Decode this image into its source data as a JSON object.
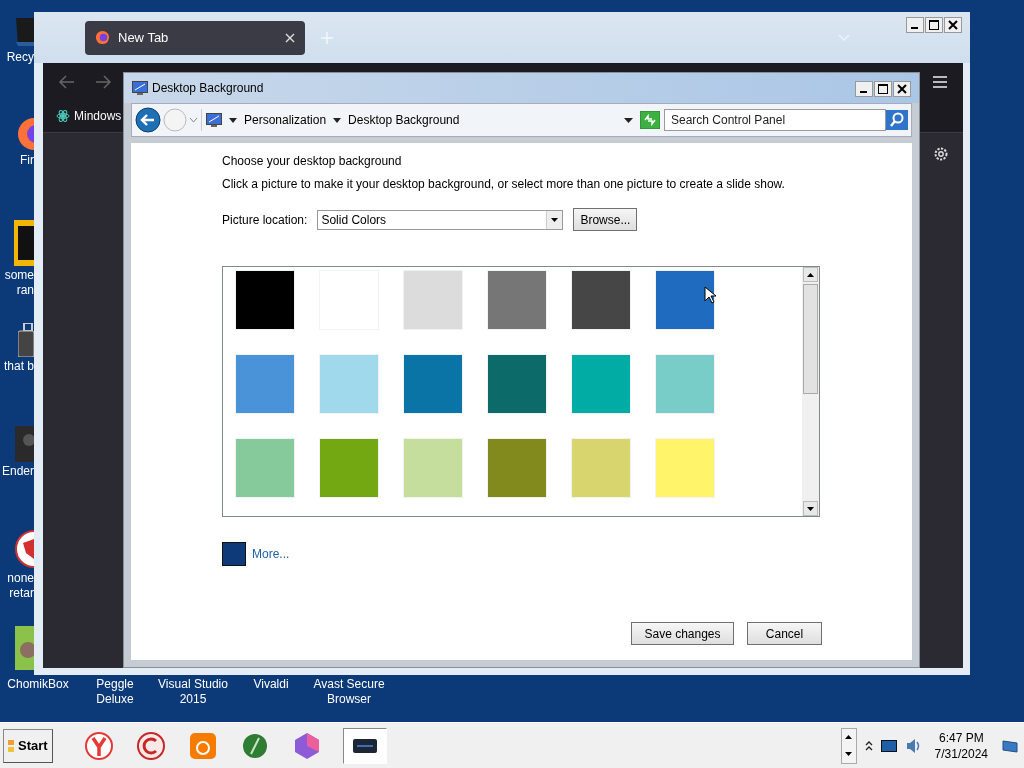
{
  "desktop": {
    "side_icons": [
      {
        "label": "Recy",
        "kind": "bin"
      },
      {
        "label": "Fir",
        "kind": "fox"
      },
      {
        "label": "some\nran",
        "kind": "yellow"
      },
      {
        "label": "that b",
        "kind": "case"
      },
      {
        "label": "Ender",
        "kind": "dark"
      },
      {
        "label": "none\nretar",
        "kind": "red"
      }
    ],
    "bottom_icons": [
      {
        "label": "ChomikBox"
      },
      {
        "label": "Peggle Deluxe"
      },
      {
        "label": "Visual Studio 2015"
      },
      {
        "label": "Vivaldi"
      },
      {
        "label": "Avast Secure Browser"
      }
    ]
  },
  "browser": {
    "tabs": [
      {
        "label": "New Tab",
        "selected": true
      }
    ],
    "bookmarks": [
      {
        "label": "Mindows"
      }
    ]
  },
  "dialog": {
    "title": "Desktop Background",
    "breadcrumb": [
      "Personalization",
      "Desktop Background"
    ],
    "search": {
      "placeholder": "Search Control Panel"
    },
    "heading": "Choose your desktop background",
    "instruction": "Click a picture to make it your desktop background, or select more than one picture to create a slide show.",
    "picture_location": {
      "label": "Picture location:",
      "value": "Solid Colors"
    },
    "browse_button": "Browse...",
    "swatches": [
      {
        "color": "#000000"
      },
      {
        "color": "#ffffff"
      },
      {
        "color": "#dcdcdc"
      },
      {
        "color": "#767676"
      },
      {
        "color": "#464646"
      },
      {
        "color": "#1e6bbf"
      },
      {
        "color": "#4b93d8"
      },
      {
        "color": "#a0d8ec"
      },
      {
        "color": "#0a74a6"
      },
      {
        "color": "#0c6a68"
      },
      {
        "color": "#00aca3"
      },
      {
        "color": "#79cdc8"
      },
      {
        "color": "#86c99a"
      },
      {
        "color": "#74a812"
      },
      {
        "color": "#c5de9e"
      },
      {
        "color": "#828a1e"
      },
      {
        "color": "#d9d56e"
      },
      {
        "color": "#fff46a"
      }
    ],
    "more": {
      "label": "More...",
      "color": "#0f3a7a"
    },
    "buttons": [
      "Save changes",
      "Cancel"
    ]
  },
  "taskbar": {
    "start": "Start",
    "apps": [
      {
        "active": false
      },
      {
        "active": false
      },
      {
        "active": false
      },
      {
        "active": false
      },
      {
        "active": false
      },
      {
        "active": true
      }
    ],
    "clock": {
      "time": "6:47 PM",
      "date": "7/31/2024"
    }
  }
}
